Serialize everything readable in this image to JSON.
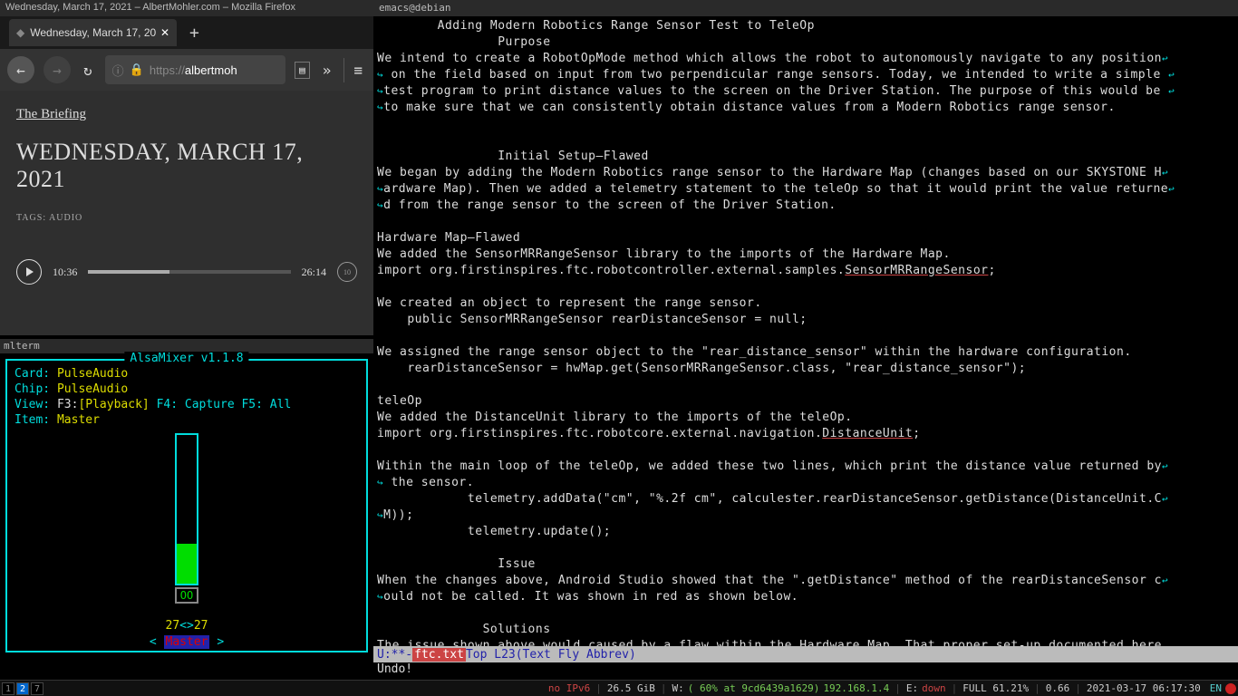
{
  "firefox": {
    "window_title": "Wednesday, March 17, 2021 – AlbertMohler.com – Mozilla Firefox",
    "tab_title": "Wednesday, March 17, 20",
    "tab_close": "✕",
    "new_tab": "+",
    "back": "←",
    "forward": "→",
    "refresh": "↻",
    "url_proto": "https://",
    "url_domain": "albertmoh",
    "reader": "☰",
    "overflow": "»",
    "menu": "≡"
  },
  "article": {
    "briefing": "The Briefing",
    "headline": "WEDNESDAY, MARCH 17, 2021",
    "tags": "TAGS: AUDIO",
    "time_current": "10:36",
    "time_total": "26:14",
    "skip": "10"
  },
  "mlterm": {
    "title": "mlterm",
    "alsa_title": " AlsaMixer v1.1.8 ",
    "card_label": "Card:",
    "card_value": "PulseAudio",
    "chip_label": "Chip:",
    "chip_value": "PulseAudio",
    "view_label": "View:",
    "view_f3": "F3:",
    "view_playback": "[Playback]",
    "view_f4": "F4: Capture",
    "view_f5": "F5: All",
    "item_label": "Item:",
    "item_value": "Master",
    "meter_oo": "OO",
    "left_val": "27",
    "sep": "<>",
    "right_val": "27",
    "larrow": "<",
    "master_label": "Master",
    "rarrow": ">"
  },
  "emacs": {
    "title": "emacs@debian",
    "modeline_left": "U:**-  ",
    "modeline_file": "ftc.txt",
    "modeline_pos": "      Top L23    ",
    "modeline_mode": "(Text Fly Abbrev)",
    "echo": "Undo!",
    "lines": {
      "h1": "        Adding Modern Robotics Range Sensor Test to TeleOp",
      "h2": "                Purpose",
      "p1a": "We intend to create a RobotOpMode method which allows the robot to autonomously navigate to any position",
      "p1b": " on the field based on input from two perpendicular range sensors. Today, we intended to write a simple ",
      "p1c": "test program to print distance values to the screen on the Driver Station. The purpose of this would be ",
      "p1d": "to make sure that we can consistently obtain distance values from a Modern Robotics range sensor.",
      "h3": "                Initial Setup—Flawed",
      "p2a": "We began by adding the Modern Robotics range sensor to the Hardware Map (changes based on our SKYSTONE H",
      "p2b": "ardware Map). Then we added a telemetry statement to the teleOp so that it would print the value returne",
      "p2c": "d from the range sensor to the screen of the Driver Station.",
      "h4": "Hardware Map—Flawed",
      "p3": "We added the SensorMRRangeSensor library to the imports of the Hardware Map.",
      "c1a": "import org.firstinspires.ftc.robotcontroller.external.samples.",
      "c1b": "SensorMRRangeSensor",
      "c1c": ";",
      "p4": "We created an object to represent the range sensor.",
      "c2": "    public SensorMRRangeSensor rearDistanceSensor = null;",
      "p5": "We assigned the range sensor object to the \"rear_distance_sensor\" within the hardware configuration.",
      "c3": "    rearDistanceSensor = hwMap.get(SensorMRRangeSensor.class, \"rear_distance_sensor\");",
      "h5": "teleOp",
      "p6": "We added the DistanceUnit library to the imports of the teleOp.",
      "c4a": "import org.firstinspires.ftc.robotcore.external.navigation.",
      "c4b": "DistanceUnit",
      "c4c": ";",
      "p7a": "Within the main loop of the teleOp, we added these two lines, which print the distance value returned by",
      "p7b": " the sensor.",
      "c5a": "            telemetry.addData(\"cm\", \"%.2f cm\", calculester.rearDistanceSensor.getDistance(DistanceUnit.C",
      "c5b": "M));",
      "c6": "            telemetry.update();",
      "h6": "                Issue",
      "p8a": "When the changes above, Android Studio showed that the \".getDistance\" method of the rearDistanceSensor c",
      "p8b": "ould not be called. It was shown in red as shown below.",
      "h7": "              Solutions",
      "p9": "The issue shown above would caused by a flaw within the Hardware Map. That proper set-up documented here"
    }
  },
  "statusbar": {
    "ws1": "1",
    "ws2": "2",
    "ws7": "7",
    "ipv6": "no IPv6",
    "mem": "26.5 GiB",
    "wlabel": "W:",
    "wpct": "( 60% at 9cd6439a1629)",
    "ip": "192.168.1.4",
    "elabel": "E:",
    "edown": "down",
    "batt": "FULL 61.21%",
    "load": "0.66",
    "datetime": "2021-03-17 06:17:30",
    "lang": "EN"
  }
}
